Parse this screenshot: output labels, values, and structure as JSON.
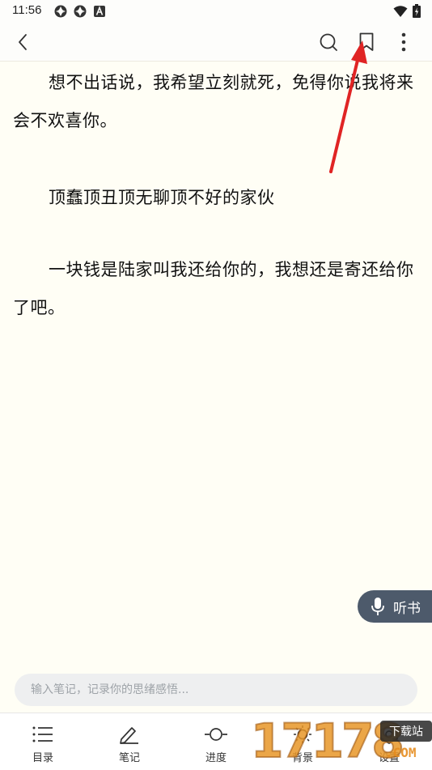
{
  "status_bar": {
    "time": "11:56",
    "left_icons": [
      "app-notification-icon",
      "app-notification-icon",
      "a-badge-icon"
    ],
    "right_icons": [
      "wifi-icon",
      "battery-charging-icon"
    ]
  },
  "toolbar": {
    "back_icon": "back-chevron-icon",
    "search_icon": "search-icon",
    "bookmark_icon": "bookmark-icon",
    "more_icon": "more-vertical-icon"
  },
  "reader": {
    "background": "#fffef5",
    "paragraphs": [
      "想不出话说，我希望立刻就死，免得你说我将来会不欢喜你。",
      "顶蠢顶丑顶无聊顶不好的家伙",
      "一块钱是陆家叫我还给你的，我想还是寄还给你了吧。"
    ]
  },
  "listen": {
    "label": "听书",
    "icon": "microphone-icon",
    "color": "#4d5a6b"
  },
  "note": {
    "placeholder": "输入笔记，记录你的思绪感悟..."
  },
  "bottom_nav": [
    {
      "label": "目录",
      "icon": "catalog-icon"
    },
    {
      "label": "笔记",
      "icon": "pen-icon"
    },
    {
      "label": "进度",
      "icon": "progress-icon"
    },
    {
      "label": "背景",
      "icon": "brightness-icon"
    },
    {
      "label": "设置",
      "icon": "settings-icon"
    }
  ],
  "annotation": {
    "color": "#e02424",
    "target": "bookmark-icon"
  },
  "watermark": {
    "digits": "17178",
    "badge": "下载站",
    "domain": ".COM"
  }
}
